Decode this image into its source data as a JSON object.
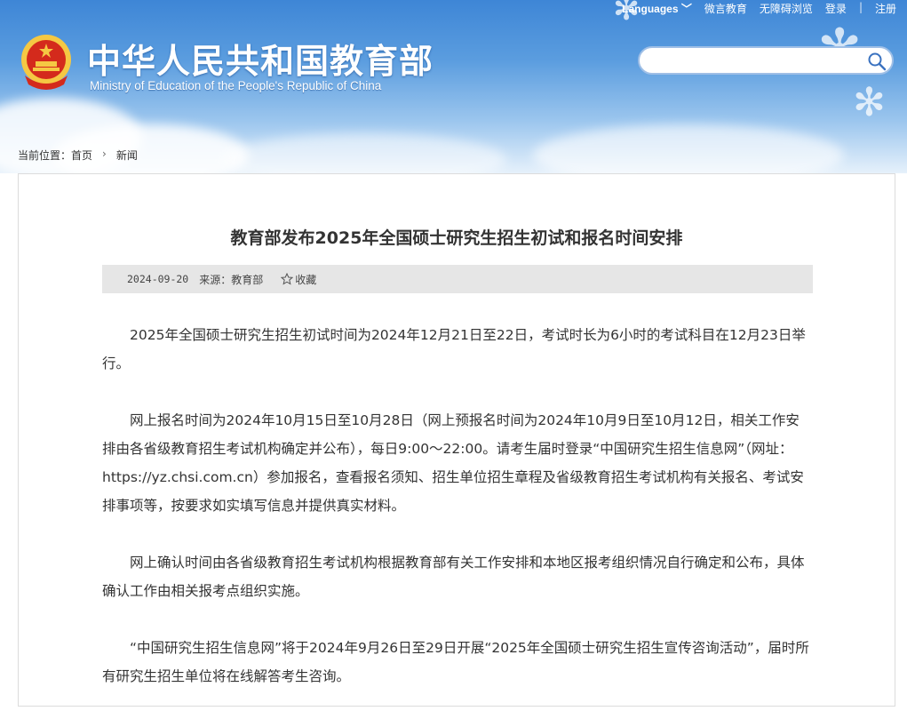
{
  "topnav": {
    "languages": "Languages",
    "weibo": "微言教育",
    "accessible": "无障碍浏览",
    "login": "登录",
    "separator": "|",
    "register": "注册"
  },
  "header": {
    "title_cn": "中华人民共和国教育部",
    "title_en": "Ministry of Education of the People's Republic of China"
  },
  "search": {
    "placeholder": "",
    "value": ""
  },
  "breadcrumb": {
    "prefix": "当前位置：",
    "home": "首页",
    "current": "新闻"
  },
  "article": {
    "title": "教育部发布2025年全国硕士研究生招生初试和报名时间安排",
    "date": "2024-09-20",
    "source": "来源：教育部",
    "favorite": "收藏",
    "paragraphs": [
      "2025年全国硕士研究生招生初试时间为2024年12月21日至22日，考试时长为6小时的考试科目在12月23日举行。",
      "网上报名时间为2024年10月15日至10月28日（网上预报名时间为2024年10月9日至10月12日，相关工作安排由各省级教育招生考试机构确定并公布），每日9:00～22:00。请考生届时登录“中国研究生招生信息网”（网址：https://yz.chsi.com.cn）参加报名，查看报名须知、招生单位招生章程及省级教育招生考试机构有关报名、考试安排事项等，按要求如实填写信息并提供真实材料。",
      "网上确认时间由各省级教育招生考试机构根据教育部有关工作安排和本地区报考组织情况自行确定和公布，具体确认工作由相关报考点组织实施。",
      "“中国研究生招生信息网”将于2024年9月26日至29日开展“2025年全国硕士研究生招生宣传咨询活动”，届时所有研究生招生单位将在线解答考生咨询。"
    ]
  },
  "colors": {
    "header_blue": "#3e86d6",
    "emblem_red": "#d42a1c",
    "emblem_gold": "#f5c843"
  }
}
